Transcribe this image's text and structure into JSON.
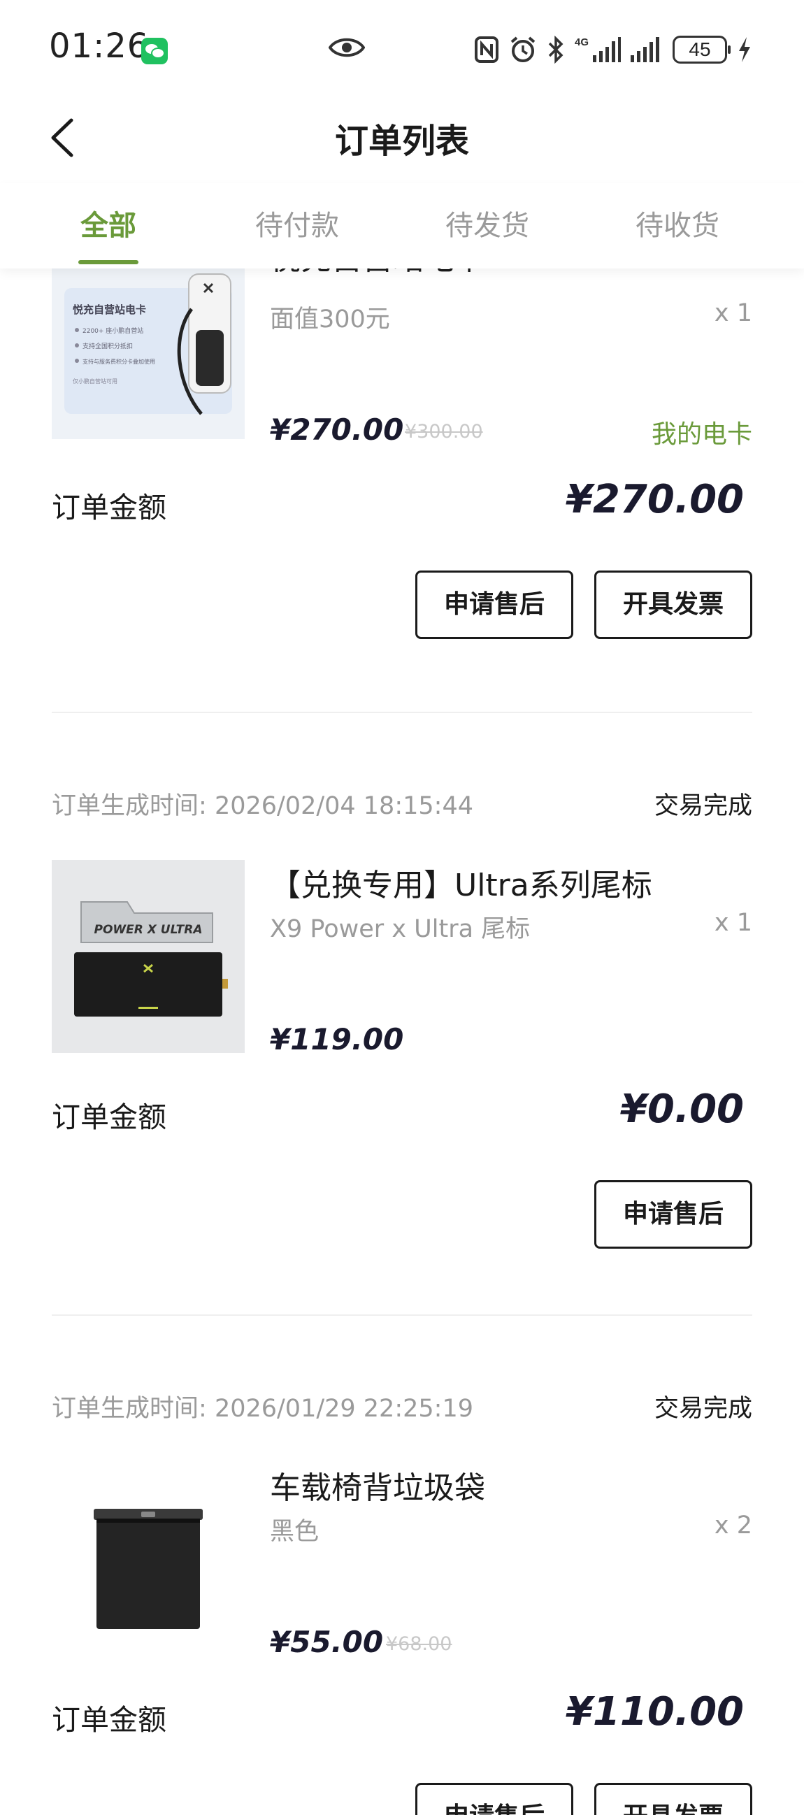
{
  "status_bar": {
    "time": "01:26",
    "battery": "45",
    "network": "4G"
  },
  "nav": {
    "title": "订单列表"
  },
  "tabs": [
    {
      "label": "全部",
      "active": true
    },
    {
      "label": "待付款",
      "active": false
    },
    {
      "label": "待发货",
      "active": false
    },
    {
      "label": "待收货",
      "active": false
    }
  ],
  "orders": [
    {
      "product_name": "悦充自营站电卡",
      "spec": "面值300元",
      "qty": "x 1",
      "price": "¥270.00",
      "original_price": "¥300.00",
      "link": "我的电卡",
      "total_label": "订单金额",
      "total": "¥270.00",
      "buttons": [
        "申请售后",
        "开具发票"
      ],
      "thumb_text": {
        "title": "悦充自营站电卡",
        "line1": "2200+ 座小鹏自营站",
        "line2": "支持全国积分抵扣",
        "line3": "支持与服务费积分卡叠加使用",
        "line4": "仅小鹏自营站可用"
      }
    },
    {
      "time_label": "订单生成时间:",
      "time": "2026/02/04 18:15:44",
      "status": "交易完成",
      "product_name": "【兑换专用】Ultra系列尾标",
      "spec": "X9 Power x Ultra 尾标",
      "qty": "x 1",
      "price": "¥119.00",
      "total_label": "订单金额",
      "total": "¥0.00",
      "buttons": [
        "申请售后"
      ],
      "thumb_text": {
        "badge": "POWER X ULTRA"
      }
    },
    {
      "time_label": "订单生成时间:",
      "time": "2026/01/29 22:25:19",
      "status": "交易完成",
      "product_name": "车载椅背垃圾袋",
      "spec": "黑色",
      "qty": "x 2",
      "price": "¥55.00",
      "original_price": "¥68.00",
      "total_label": "订单金额",
      "total": "¥110.00",
      "buttons": [
        "申请售后",
        "开具发票"
      ]
    }
  ],
  "colors": {
    "accent": "#6a9a3a",
    "text": "#1a1a1a",
    "muted": "#9a9a9a",
    "wechat": "#20c160"
  },
  "icons": [
    "wechat-icon",
    "eye-icon",
    "nfc-icon",
    "alarm-icon",
    "bluetooth-icon",
    "signal-icon",
    "battery-icon",
    "charging-icon",
    "back-icon"
  ]
}
